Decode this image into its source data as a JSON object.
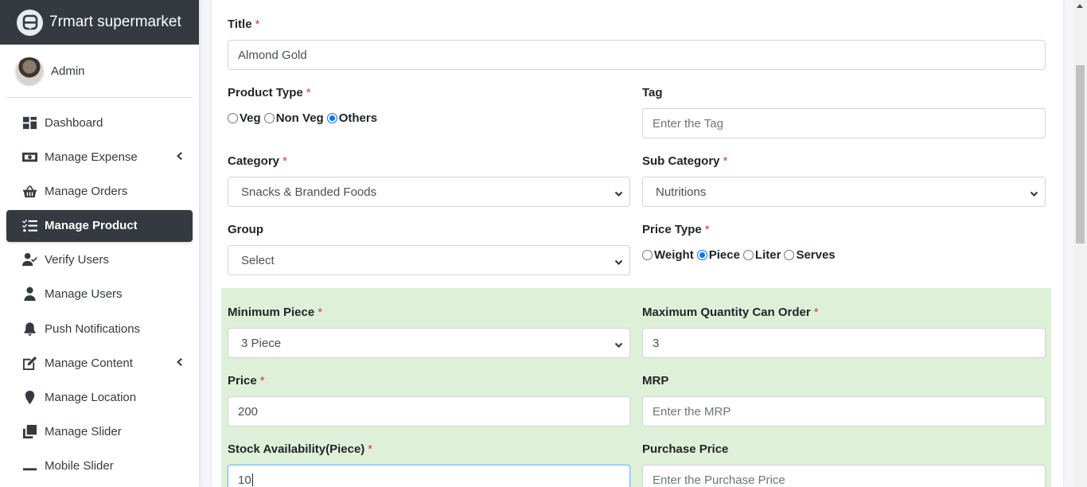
{
  "brand": {
    "name": "7rmart supermarket",
    "logo_icon": "admin-logo-icon"
  },
  "user": {
    "name": "Admin"
  },
  "sidebar": {
    "items": [
      {
        "label": "Dashboard",
        "icon": "dashboard-icon"
      },
      {
        "label": "Manage Expense",
        "icon": "money-bill-icon",
        "has_submenu": true
      },
      {
        "label": "Manage Orders",
        "icon": "basket-icon"
      },
      {
        "label": "Manage Product",
        "icon": "tasks-icon",
        "active": true
      },
      {
        "label": "Verify Users",
        "icon": "user-check-icon"
      },
      {
        "label": "Manage Users",
        "icon": "user-icon"
      },
      {
        "label": "Push Notifications",
        "icon": "bell-icon"
      },
      {
        "label": "Manage Content",
        "icon": "edit-icon",
        "has_submenu": true
      },
      {
        "label": "Manage Location",
        "icon": "map-marker-icon"
      },
      {
        "label": "Manage Slider",
        "icon": "clone-icon"
      },
      {
        "label": "Mobile Slider",
        "icon": "minus-icon"
      }
    ]
  },
  "form": {
    "title": {
      "label": "Title",
      "required": "*",
      "value": "Almond Gold"
    },
    "product_type": {
      "label": "Product Type",
      "required": "*",
      "options": [
        "Veg",
        "Non Veg",
        "Others"
      ],
      "selected": "Others"
    },
    "tag": {
      "label": "Tag",
      "placeholder": "Enter the Tag"
    },
    "category": {
      "label": "Category",
      "required": "*",
      "value": "Snacks & Branded Foods"
    },
    "sub_category": {
      "label": "Sub Category",
      "required": "*",
      "value": "Nutritions"
    },
    "group": {
      "label": "Group",
      "value": "Select"
    },
    "price_type": {
      "label": "Price Type",
      "required": "*",
      "options": [
        "Weight",
        "Piece",
        "Liter",
        "Serves"
      ],
      "selected": "Piece"
    },
    "minimum_piece": {
      "label": "Minimum Piece",
      "required": "*",
      "value": "3 Piece"
    },
    "max_quantity": {
      "label": "Maximum Quantity Can Order",
      "required": "*",
      "value": "3"
    },
    "price": {
      "label": "Price",
      "required": "*",
      "value": "200"
    },
    "mrp": {
      "label": "MRP",
      "placeholder": "Enter the MRP"
    },
    "stock": {
      "label": "Stock Availability(Piece)",
      "required": "*",
      "value": "10"
    },
    "purchase_price": {
      "label": "Purchase Price",
      "placeholder": "Enter the Purchase Price"
    }
  },
  "colors": {
    "sidebar_dark": "#343a40",
    "green_block": "#dff0d8",
    "required": "#dc3545",
    "radio_checked": "#0075ff"
  }
}
